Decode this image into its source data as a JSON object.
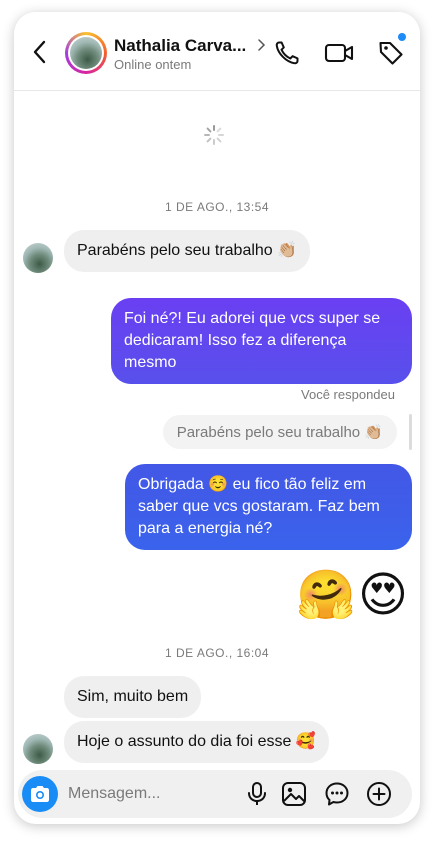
{
  "header": {
    "contact_name": "Nathalia Carva...",
    "status": "Online ontem"
  },
  "icons": {
    "back": "chevron-left-icon",
    "profile": "chevron-right-icon",
    "call": "phone-icon",
    "video": "video-camera-icon",
    "tag": "tag-icon",
    "loading": "spinner-icon",
    "camera": "camera-icon",
    "mic": "microphone-icon",
    "gallery": "image-icon",
    "sticker": "chat-bubble-icon",
    "add": "plus-circle-icon"
  },
  "thread": {
    "timestamp_1": "1 DE AGO., 13:54",
    "msg_in_1": "Parabéns pelo seu trabalho 👏🏼",
    "msg_out_1": "Foi né?! Eu adorei que vcs super se dedicaram! Isso fez a diferença mesmo",
    "replied_label": "Você respondeu",
    "quoted_text": "Parabéns pelo seu trabalho 👏🏼",
    "msg_out_2": "Obrigada ☺️ eu fico tão feliz em saber que vcs gostaram. Faz bem para a energia né?",
    "emoji_msg": "🤗😍",
    "timestamp_2": "1 DE AGO., 16:04",
    "msg_in_2": "Sim, muito bem",
    "msg_in_3": "Hoje o assunto do dia foi esse 🥰"
  },
  "composer": {
    "placeholder": "Mensagem..."
  },
  "colors": {
    "accent_blue": "#1a8cf5",
    "bubble_out_purple": "#6a3ff2",
    "bubble_out_blue": "#3a63ec",
    "bubble_in": "#efefef",
    "unread_dot": "#1d8cf8"
  }
}
